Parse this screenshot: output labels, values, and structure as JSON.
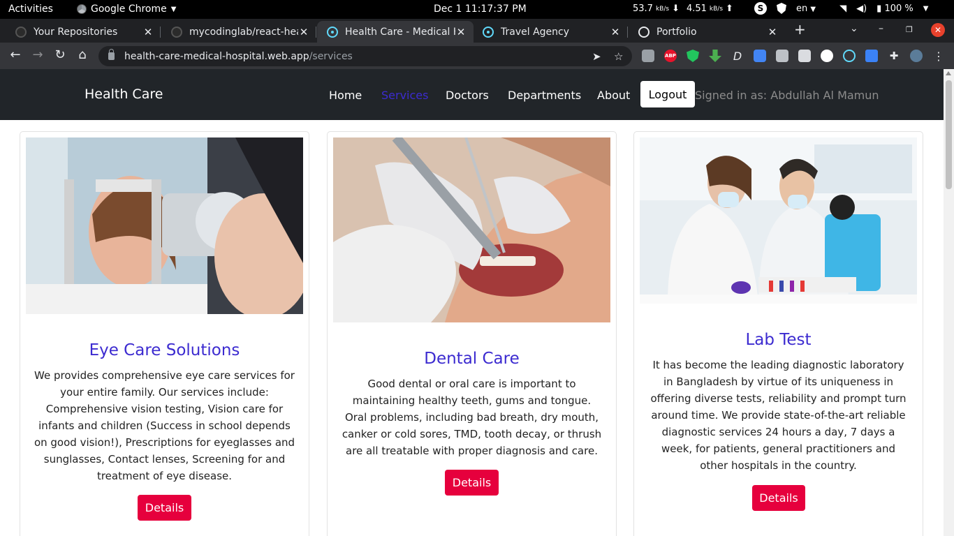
{
  "topbar": {
    "activities": "Activities",
    "app": "Google Chrome",
    "clock": "Dec 1  11:17:37 PM",
    "net_down": "53.7",
    "net_down_unit": "kB/s",
    "net_up": "4.51",
    "net_up_unit": "kB/s",
    "lang": "en",
    "battery": "100 %"
  },
  "tabs": [
    {
      "label": "Your Repositories",
      "icon": "github-icon"
    },
    {
      "label": "mycodinglab/react-hea",
      "icon": "github-icon"
    },
    {
      "label": "Health Care - Medical H",
      "icon": "react-icon",
      "active": true
    },
    {
      "label": "Travel Agency",
      "icon": "react-icon"
    },
    {
      "label": "Portfolio",
      "icon": "globe-icon"
    }
  ],
  "omnibox": {
    "host": "health-care-medical-hospital.web.app",
    "path": "/services"
  },
  "site": {
    "brand": "Health Care",
    "nav": [
      "Home",
      "Services",
      "Doctors",
      "Departments",
      "About"
    ],
    "active_nav": "Services",
    "logout": "Logout",
    "signed_in": "Signed in as: Abdullah Al Mamun",
    "accent": "#3c2bd0",
    "button_color": "#e6003d",
    "services": [
      {
        "title": "Eye Care Solutions",
        "description": "We provides comprehensive eye care services for your entire family. Our services include: Comprehensive vision testing, Vision care for infants and children (Success in school depends on good vision!), Prescriptions for eyeglasses and sunglasses, Contact lenses, Screening for and treatment of eye disease.",
        "button": "Details"
      },
      {
        "title": "Dental Care",
        "description": "Good dental or oral care is important to maintaining healthy teeth, gums and tongue. Oral problems, including bad breath, dry mouth, canker or cold sores, TMD, tooth decay, or thrush are all treatable with proper diagnosis and care.",
        "button": "Details"
      },
      {
        "title": "Lab Test",
        "description": "It has become the leading diagnostic laboratory in Bangladesh by virtue of its uniqueness in offering diverse tests, reliability and prompt turn around time. We provide state-of-the-art reliable diagnostic services 24 hours a day, 7 days a week, for patients, general practitioners and other hospitals in the country.",
        "button": "Details"
      }
    ]
  }
}
